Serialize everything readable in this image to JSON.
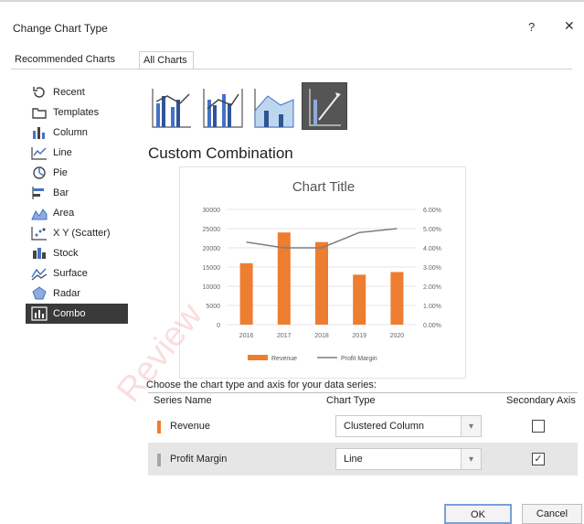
{
  "dialog": {
    "title": "Change Chart Type",
    "help_glyph": "?",
    "close_glyph": "✕"
  },
  "tabs": [
    "Recommended Charts",
    "All Charts"
  ],
  "sidebar": {
    "items": [
      {
        "label": "Recent",
        "icon": "recent-icon"
      },
      {
        "label": "Templates",
        "icon": "templates-icon"
      },
      {
        "label": "Column",
        "icon": "column-chart-icon"
      },
      {
        "label": "Line",
        "icon": "line-chart-icon"
      },
      {
        "label": "Pie",
        "icon": "pie-chart-icon"
      },
      {
        "label": "Bar",
        "icon": "bar-chart-icon"
      },
      {
        "label": "Area",
        "icon": "area-chart-icon"
      },
      {
        "label": "X Y (Scatter)",
        "icon": "scatter-chart-icon"
      },
      {
        "label": "Stock",
        "icon": "stock-chart-icon"
      },
      {
        "label": "Surface",
        "icon": "surface-chart-icon"
      },
      {
        "label": "Radar",
        "icon": "radar-chart-icon"
      },
      {
        "label": "Combo",
        "icon": "combo-chart-icon"
      }
    ],
    "selected_index": 11
  },
  "subtypes": [
    {
      "name": "clustered-column-line-icon"
    },
    {
      "name": "clustered-column-line-secondary-icon"
    },
    {
      "name": "stacked-area-column-icon"
    },
    {
      "name": "custom-combination-icon"
    }
  ],
  "combo_heading": "Custom Combination",
  "chart_data": {
    "type": "bar",
    "title": "Chart Title",
    "categories": [
      "2016",
      "2017",
      "2018",
      "2019",
      "2020"
    ],
    "series": [
      {
        "name": "Revenue",
        "type": "bar",
        "axis": "primary",
        "color": "#ED7D31",
        "values": [
          16000,
          24000,
          21500,
          13000,
          13700
        ]
      },
      {
        "name": "Profit Margin",
        "type": "line",
        "axis": "secondary",
        "color": "#7F7F7F",
        "values": [
          0.043,
          0.04,
          0.04,
          0.048,
          0.05
        ]
      }
    ],
    "y_primary": {
      "min": 0,
      "max": 30000,
      "ticks": [
        "30000",
        "25000",
        "20000",
        "15000",
        "10000",
        "5000",
        "0"
      ]
    },
    "y_secondary": {
      "min": 0,
      "max": 0.06,
      "ticks": [
        "6.00%",
        "5.00%",
        "4.00%",
        "3.00%",
        "2.00%",
        "1.00%",
        "0.00%"
      ]
    },
    "gridlines": true,
    "legend_position": "bottom"
  },
  "series_caption": "Choose the chart type and axis for your data series:",
  "series_table": {
    "headers": {
      "name": "Series Name",
      "type": "Chart Type",
      "axis": "Secondary Axis"
    },
    "rows": [
      {
        "name": "Revenue",
        "swatch": "#ED7D31",
        "type": "Clustered Column",
        "secondary": false
      },
      {
        "name": "Profit Margin",
        "swatch": "#A5A5A5",
        "type": "Line",
        "secondary": true
      }
    ]
  },
  "buttons": {
    "ok": "OK",
    "cancel": "Cancel"
  },
  "watermark": "Review"
}
